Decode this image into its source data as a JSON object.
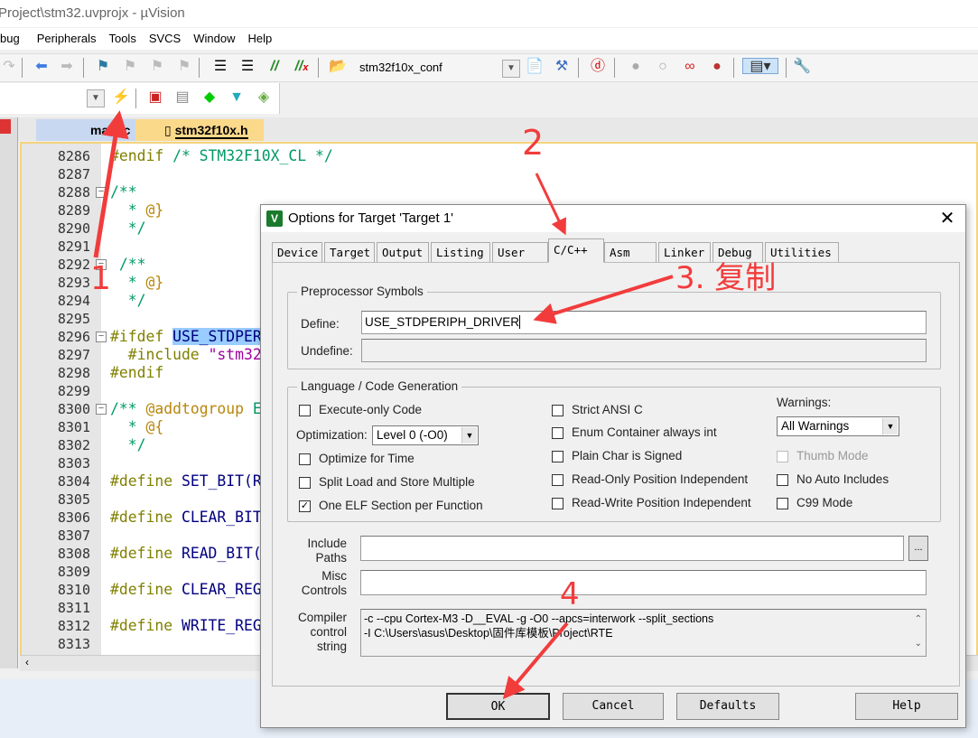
{
  "window": {
    "title": "Project\\stm32.uvprojx - µVision"
  },
  "menu": [
    "bug",
    "Peripherals",
    "Tools",
    "SVCS",
    "Window",
    "Help"
  ],
  "toolbar": {
    "target_name": "stm32f10x_conf"
  },
  "file_tabs": [
    {
      "label": "main.c",
      "active": false
    },
    {
      "label": "stm32f10x.h",
      "active": true
    }
  ],
  "editor": {
    "lines": [
      {
        "n": "8286",
        "tokens": [
          {
            "t": "#endif ",
            "c": "pp"
          },
          {
            "t": "/* STM32F10X_CL */",
            "c": "cm"
          }
        ]
      },
      {
        "n": "8287",
        "tokens": []
      },
      {
        "n": "8288",
        "fold": true,
        "tokens": [
          {
            "t": "/**",
            "c": "cm"
          }
        ]
      },
      {
        "n": "8289",
        "tokens": [
          {
            "t": "  * ",
            "c": "cm"
          },
          {
            "t": "@}",
            "c": "tag"
          }
        ]
      },
      {
        "n": "8290",
        "tokens": [
          {
            "t": "  */",
            "c": "cm"
          }
        ]
      },
      {
        "n": "8291",
        "tokens": []
      },
      {
        "n": "8292",
        "fold": true,
        "tokens": [
          {
            "t": " /**",
            "c": "cm"
          }
        ]
      },
      {
        "n": "8293",
        "tokens": [
          {
            "t": "  * ",
            "c": "cm"
          },
          {
            "t": "@}",
            "c": "tag"
          }
        ]
      },
      {
        "n": "8294",
        "tokens": [
          {
            "t": "  */",
            "c": "cm"
          }
        ]
      },
      {
        "n": "8295",
        "tokens": []
      },
      {
        "n": "8296",
        "fold": true,
        "tokens": [
          {
            "t": "#ifdef ",
            "c": "pp"
          },
          {
            "t": "USE_STDPER",
            "c": "sel"
          }
        ]
      },
      {
        "n": "8297",
        "tokens": [
          {
            "t": "  #include ",
            "c": "pp"
          },
          {
            "t": "\"stm32",
            "c": "str"
          }
        ]
      },
      {
        "n": "8298",
        "tokens": [
          {
            "t": "#endif",
            "c": "pp"
          }
        ]
      },
      {
        "n": "8299",
        "tokens": []
      },
      {
        "n": "8300",
        "fold": true,
        "tokens": [
          {
            "t": "/** ",
            "c": "cm"
          },
          {
            "t": "@addtogroup ",
            "c": "tag"
          },
          {
            "t": "E",
            "c": "cm"
          }
        ]
      },
      {
        "n": "8301",
        "tokens": [
          {
            "t": "  * ",
            "c": "cm"
          },
          {
            "t": "@{",
            "c": "tag"
          }
        ]
      },
      {
        "n": "8302",
        "tokens": [
          {
            "t": "  */",
            "c": "cm"
          }
        ]
      },
      {
        "n": "8303",
        "tokens": []
      },
      {
        "n": "8304",
        "tokens": [
          {
            "t": "#define ",
            "c": "pp"
          },
          {
            "t": "SET_BIT(R",
            "c": "id"
          }
        ]
      },
      {
        "n": "8305",
        "tokens": []
      },
      {
        "n": "8306",
        "tokens": [
          {
            "t": "#define ",
            "c": "pp"
          },
          {
            "t": "CLEAR_BIT",
            "c": "id"
          }
        ]
      },
      {
        "n": "8307",
        "tokens": []
      },
      {
        "n": "8308",
        "tokens": [
          {
            "t": "#define ",
            "c": "pp"
          },
          {
            "t": "READ_BIT(",
            "c": "id"
          }
        ]
      },
      {
        "n": "8309",
        "tokens": []
      },
      {
        "n": "8310",
        "tokens": [
          {
            "t": "#define ",
            "c": "pp"
          },
          {
            "t": "CLEAR_REG",
            "c": "id"
          }
        ]
      },
      {
        "n": "8311",
        "tokens": []
      },
      {
        "n": "8312",
        "tokens": [
          {
            "t": "#define ",
            "c": "pp"
          },
          {
            "t": "WRITE_REG",
            "c": "id"
          }
        ]
      },
      {
        "n": "8313",
        "tokens": []
      }
    ]
  },
  "dialog": {
    "title": "Options for Target 'Target 1'",
    "tabs": [
      "Device",
      "Target",
      "Output",
      "Listing",
      "User",
      "C/C++",
      "Asm",
      "Linker",
      "Debug",
      "Utilities"
    ],
    "active_tab": "C/C++",
    "preprocessor": {
      "group_label": "Preprocessor Symbols",
      "define_label": "Define:",
      "define_value": "USE_STDPERIPH_DRIVER",
      "undefine_label": "Undefine:",
      "undefine_value": ""
    },
    "language": {
      "group_label": "Language / Code Generation",
      "execute_only": {
        "label": "Execute-only Code",
        "checked": false
      },
      "optimization_label": "Optimization:",
      "optimization_value": "Level 0 (-O0)",
      "optimize_time": {
        "label": "Optimize for Time",
        "checked": false
      },
      "split_load": {
        "label": "Split Load and Store Multiple",
        "checked": false
      },
      "one_elf": {
        "label": "One ELF Section per Function",
        "checked": true
      },
      "strict_ansi": {
        "label": "Strict ANSI C",
        "checked": false
      },
      "enum_container": {
        "label": "Enum Container always int",
        "checked": false
      },
      "plain_char": {
        "label": "Plain Char is Signed",
        "checked": false
      },
      "ropi": {
        "label": "Read-Only Position Independent",
        "checked": false
      },
      "rwpi": {
        "label": "Read-Write Position Independent",
        "checked": false
      },
      "warnings_label": "Warnings:",
      "warnings_value": "All Warnings",
      "thumb_mode": {
        "label": "Thumb Mode",
        "checked": false,
        "disabled": true
      },
      "no_auto_includes": {
        "label": "No Auto Includes",
        "checked": false
      },
      "c99_mode": {
        "label": "C99 Mode",
        "checked": false
      }
    },
    "include_paths": {
      "label_1": "Include",
      "label_2": "Paths",
      "value": "",
      "browse": "..."
    },
    "misc_controls": {
      "label_1": "Misc",
      "label_2": "Controls",
      "value": ""
    },
    "compiler_string": {
      "label_1": "Compiler",
      "label_2": "control",
      "label_3": "string",
      "line_1": "-c --cpu Cortex-M3 -D__EVAL -g -O0 --apcs=interwork --split_sections",
      "line_2": "-I C:\\Users\\asus\\Desktop\\固件库模板\\Project\\RTE"
    },
    "buttons": {
      "ok": "OK",
      "cancel": "Cancel",
      "defaults": "Defaults",
      "help": "Help"
    }
  },
  "annotations": {
    "step1": "1",
    "step2": "2",
    "step3": "3. 复制",
    "step4": "4",
    "color": "#f23c3c"
  }
}
